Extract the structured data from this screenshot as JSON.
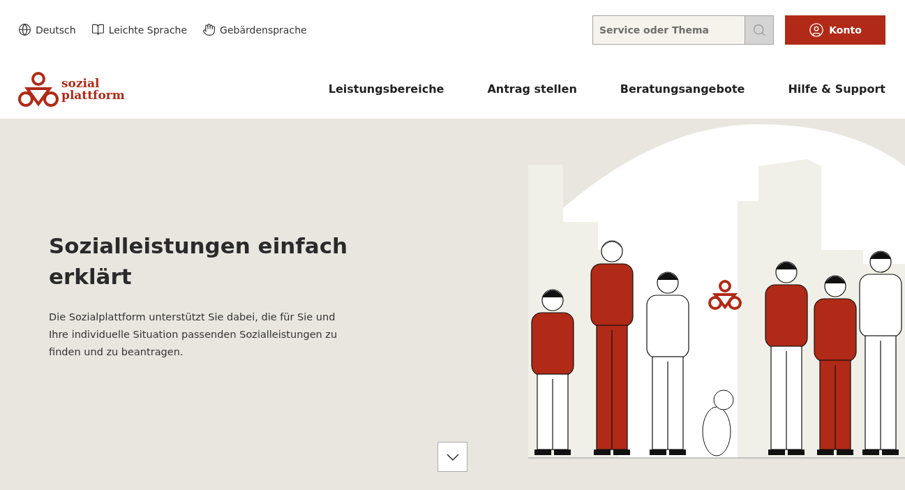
{
  "utility_links": [
    {
      "kind": "language",
      "label": "Deutsch"
    },
    {
      "kind": "easy",
      "label": "Leichte Sprache"
    },
    {
      "kind": "sign",
      "label": "Gebärdensprache"
    }
  ],
  "search": {
    "placeholder": "Service oder Thema"
  },
  "account_button": {
    "label": "Konto"
  },
  "logo": {
    "line_1": "sozial",
    "line_2": "plattform"
  },
  "nav": [
    {
      "label": "Leistungsbereiche"
    },
    {
      "label": "Antrag stellen"
    },
    {
      "label": "Beratungsangebote"
    },
    {
      "label": "Hilfe & Support"
    }
  ],
  "hero": {
    "title": "Sozialleistungen einfach erklärt",
    "text": "Die Sozialplattform unterstützt Sie dabei, die für Sie und Ihre individuelle Situation passenden Sozialleistungen zu finden und zu beantragen."
  }
}
